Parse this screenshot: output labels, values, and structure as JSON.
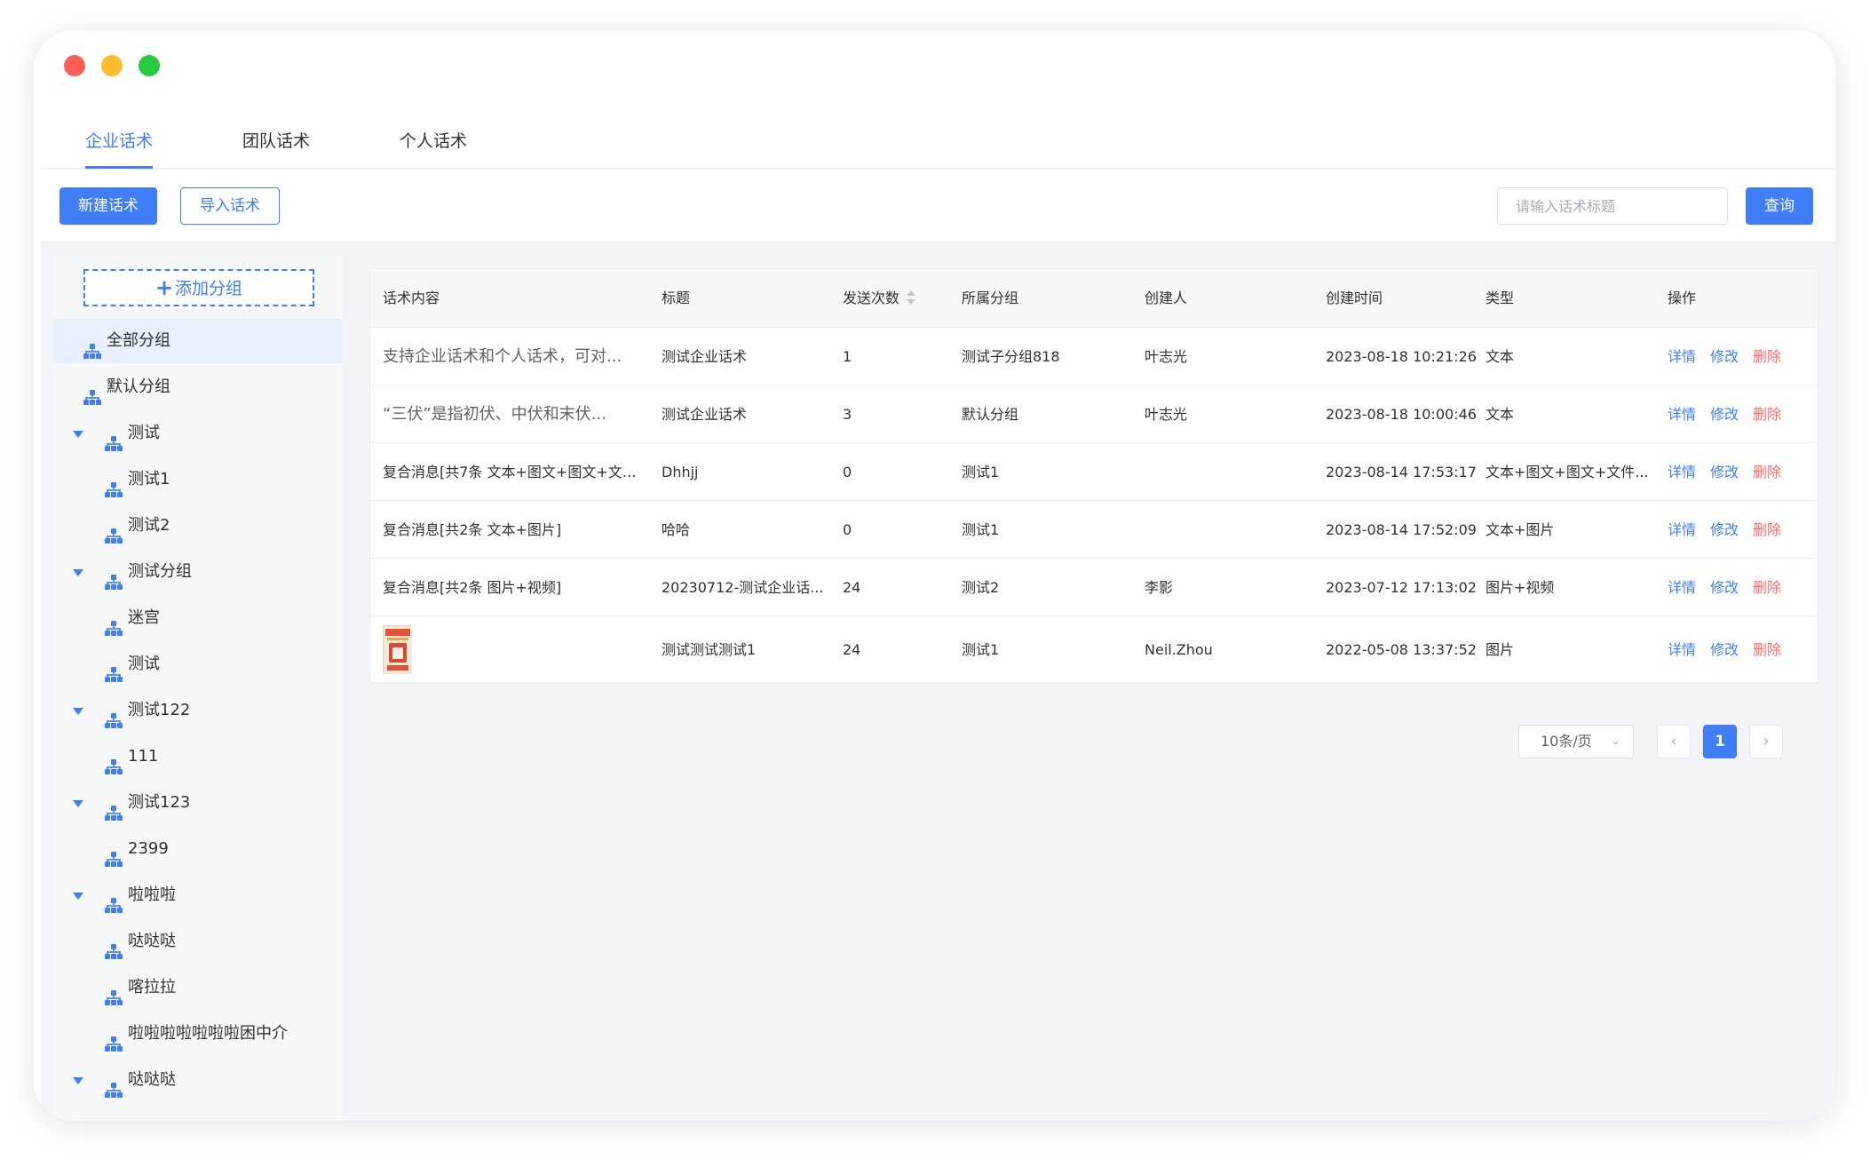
{
  "tabs": [
    {
      "label": "企业话术",
      "active": true
    },
    {
      "label": "团队话术",
      "active": false
    },
    {
      "label": "个人话术",
      "active": false
    }
  ],
  "toolbar": {
    "new_label": "新建话术",
    "import_label": "导入话术",
    "search_placeholder": "请输入话术标题",
    "search_value": "",
    "query_label": "查询"
  },
  "sidebar": {
    "add_group_label": "添加分组",
    "items": [
      {
        "label": "全部分组",
        "level": 0,
        "selected": true
      },
      {
        "label": "默认分组",
        "level": 0
      },
      {
        "label": "测试",
        "level": 1,
        "expanded": true
      },
      {
        "label": "测试1",
        "level": 2
      },
      {
        "label": "测试2",
        "level": 2
      },
      {
        "label": "测试分组",
        "level": 1,
        "expanded": true
      },
      {
        "label": "迷宫",
        "level": 2
      },
      {
        "label": "测试",
        "level": 2
      },
      {
        "label": "测试122",
        "level": 1,
        "expanded": true
      },
      {
        "label": "111",
        "level": 2
      },
      {
        "label": "测试123",
        "level": 1,
        "expanded": true
      },
      {
        "label": "2399",
        "level": 2
      },
      {
        "label": "啦啦啦",
        "level": 1,
        "expanded": true
      },
      {
        "label": "哒哒哒",
        "level": 2
      },
      {
        "label": "喀拉拉",
        "level": 2
      },
      {
        "label": "啦啦啦啦啦啦啦困中介",
        "level": 2
      },
      {
        "label": "哒哒哒",
        "level": 1,
        "expanded": true
      }
    ]
  },
  "table": {
    "columns": [
      "话术内容",
      "标题",
      "发送次数",
      "所属分组",
      "创建人",
      "创建时间",
      "类型",
      "操作"
    ],
    "rows": [
      {
        "content": "支持企业话术和个人话术，可对...",
        "title": "测试企业话术",
        "count": "1",
        "group": "测试子分组818",
        "creator": "叶志光",
        "created": "2023-08-18 10:21:26",
        "type": "文本"
      },
      {
        "content": "“三伏”是指初伏、中伏和末伏...",
        "title": "测试企业话术",
        "count": "3",
        "group": "默认分组",
        "creator": "叶志光",
        "created": "2023-08-18 10:00:46",
        "type": "文本"
      },
      {
        "content": "复合消息[共7条 文本+图文+图文+文件...",
        "title": "Dhhjj",
        "count": "0",
        "group": "测试1",
        "creator": "",
        "created": "2023-08-14 17:53:17",
        "type": "文本+图文+图文+文件..."
      },
      {
        "content": "复合消息[共2条 文本+图片]",
        "title": "哈哈",
        "count": "0",
        "group": "测试1",
        "creator": "",
        "created": "2023-08-14 17:52:09",
        "type": "文本+图片"
      },
      {
        "content": "复合消息[共2条 图片+视频]",
        "title": "20230712-测试企业话...",
        "count": "24",
        "group": "测试2",
        "creator": "李影",
        "created": "2023-07-12 17:13:02",
        "type": "图片+视频"
      },
      {
        "content": "",
        "title": "测试测试测试1",
        "count": "24",
        "group": "测试1",
        "creator": "Neil.Zhou",
        "created": "2022-05-08 13:37:52",
        "type": "图片",
        "image": true
      }
    ],
    "actions": {
      "detail": "详情",
      "edit": "修改",
      "delete": "删除"
    }
  },
  "pagination": {
    "page_size": "10条/页",
    "current_page": "1",
    "prev_icon": "chevron-left-icon",
    "next_icon": "chevron-right-icon"
  },
  "colors": {
    "accent": "#3f7ef6",
    "danger": "#f56c6c"
  }
}
